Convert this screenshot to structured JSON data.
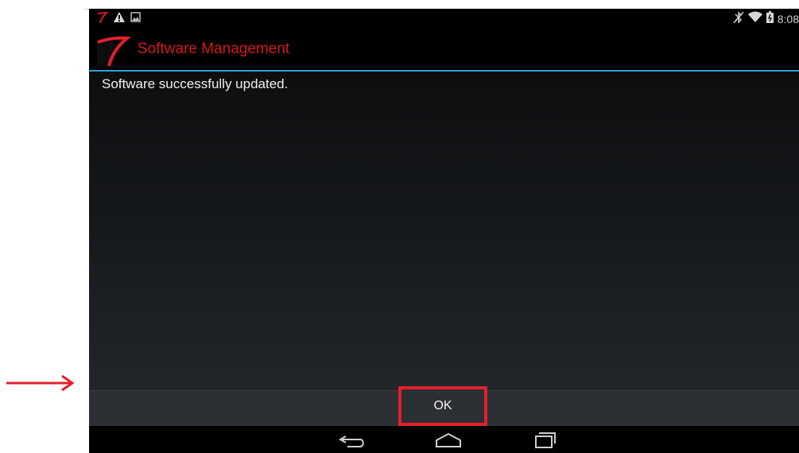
{
  "status_bar": {
    "left_icons": [
      "app-notification-icon",
      "warning-icon",
      "image-icon"
    ],
    "right_icons": [
      "bluetooth-off-icon",
      "wifi-icon",
      "battery-icon"
    ],
    "time": "8:08"
  },
  "action_bar": {
    "title": "Software Management",
    "icon": "app-logo-icon"
  },
  "dialog": {
    "message": "Software successfully updated.",
    "ok_label": "OK"
  },
  "nav_bar": {
    "buttons": [
      "back-icon",
      "home-icon",
      "recent-apps-icon"
    ]
  },
  "annotation": {
    "arrow_icon": "right-arrow-icon",
    "highlight_color": "#e2202c"
  },
  "colors": {
    "title_red": "#d6191c",
    "divider_blue": "#2aa7d6",
    "background": "#000000"
  }
}
